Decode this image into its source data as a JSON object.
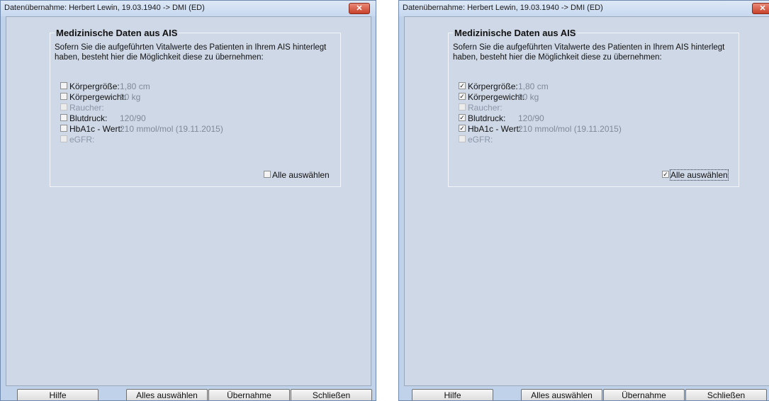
{
  "windows": [
    {
      "title": "Datenübernahme: Herbert Lewin, 19.03.1940 -> DMI (ED)",
      "close_symbol": "✕",
      "group_title": "Medizinische Daten aus AIS",
      "description": "Sofern Sie die aufgeführten Vitalwerte des Patienten in Ihrem AIS hinterlegt haben, besteht hier die Möglichkeit diese zu übernehmen:",
      "fields": [
        {
          "label": "Körpergröße:",
          "value": "1,80 cm",
          "checked": false,
          "enabled": true
        },
        {
          "label": "Körpergewicht:",
          "value": "90 kg",
          "checked": false,
          "enabled": true
        },
        {
          "label": "Raucher:",
          "value": "",
          "checked": false,
          "enabled": false
        },
        {
          "label": "Blutdruck:",
          "value": "120/90",
          "checked": false,
          "enabled": true
        },
        {
          "label": "HbA1c - Wert:",
          "value": "210 mmol/mol (19.11.2015)",
          "checked": false,
          "enabled": true
        },
        {
          "label": "eGFR:",
          "value": "",
          "checked": false,
          "enabled": false
        }
      ],
      "select_all": {
        "label": "Alle auswählen",
        "checked": false,
        "focused": false
      },
      "buttons": {
        "help": "Hilfe",
        "select_all": "Alles auswählen",
        "apply": "Übernahme",
        "close": "Schließen"
      }
    },
    {
      "title": "Datenübernahme: Herbert Lewin, 19.03.1940 -> DMI (ED)",
      "close_symbol": "✕",
      "group_title": "Medizinische Daten aus AIS",
      "description": "Sofern Sie die aufgeführten Vitalwerte des Patienten in Ihrem AIS hinterlegt haben, besteht hier die Möglichkeit diese zu übernehmen:",
      "fields": [
        {
          "label": "Körpergröße:",
          "value": "1,80 cm",
          "checked": true,
          "enabled": true
        },
        {
          "label": "Körpergewicht:",
          "value": "90 kg",
          "checked": true,
          "enabled": true
        },
        {
          "label": "Raucher:",
          "value": "",
          "checked": false,
          "enabled": false
        },
        {
          "label": "Blutdruck:",
          "value": "120/90",
          "checked": true,
          "enabled": true
        },
        {
          "label": "HbA1c - Wert:",
          "value": "210 mmol/mol (19.11.2015)",
          "checked": true,
          "enabled": true
        },
        {
          "label": "eGFR:",
          "value": "",
          "checked": false,
          "enabled": false
        }
      ],
      "select_all": {
        "label": "Alle auswählen",
        "checked": true,
        "focused": true
      },
      "buttons": {
        "help": "Hilfe",
        "select_all": "Alles auswählen",
        "apply": "Übernahme",
        "close": "Schließen"
      }
    }
  ],
  "check_mark": "✓"
}
